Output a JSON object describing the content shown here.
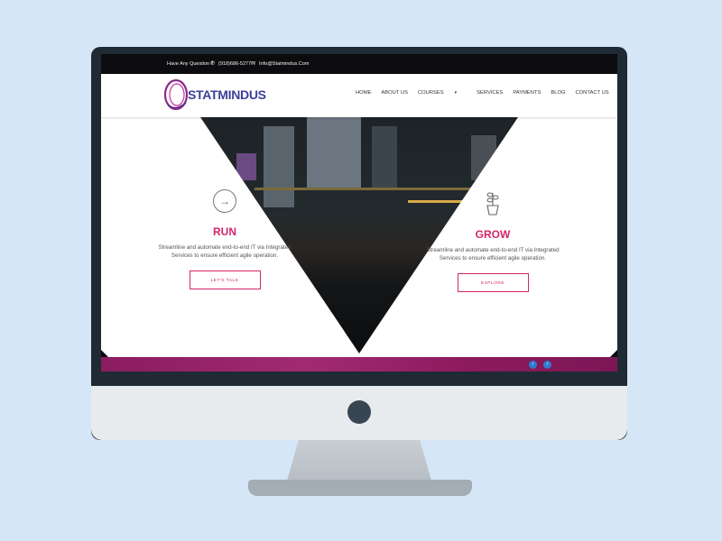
{
  "topbar": {
    "question": "Have Any Question ?",
    "phone": "(918)686-5277",
    "email": "Info@Statmindus.Com"
  },
  "brand": {
    "name": "STATMINDUS"
  },
  "nav": {
    "items": [
      "HOME",
      "ABOUT US",
      "COURSES",
      "SERVICES",
      "PAYMENTS",
      "BLOG",
      "CONTACT US"
    ]
  },
  "hero": {
    "left": {
      "title": "RUN",
      "text": "Streamline and automate end-to-end IT via Integrated Services to ensure efficient agile operation.",
      "button": "LET'S TALK",
      "icon": "arrow-circle-icon"
    },
    "right": {
      "title": "GROW",
      "text": "Streamline and automate end-to-end IT via Integrated Services to ensure efficient agile operation.",
      "button": "EXPLORE",
      "icon": "plant-icon"
    }
  },
  "colors": {
    "accent": "#d4256b",
    "brand": "#3b3f9a",
    "footer": "#8a1c5f",
    "topbar": "#0c0c0e"
  }
}
